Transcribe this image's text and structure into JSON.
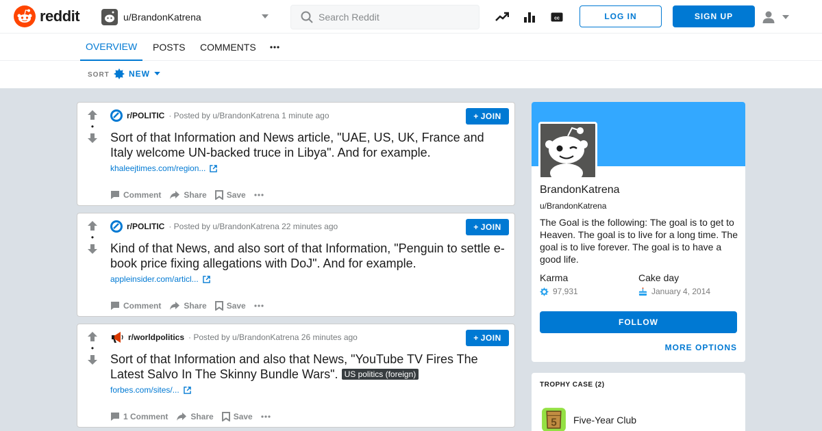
{
  "header": {
    "logo_text": "reddit",
    "user_dropdown_label": "u/BrandonKatrena",
    "search_placeholder": "Search Reddit",
    "login_label": "LOG IN",
    "signup_label": "SIGN UP",
    "icons": [
      "trending-icon",
      "stats-icon",
      "closed-caption-icon",
      "user-icon",
      "chevron-down-icon"
    ]
  },
  "tabs": [
    {
      "label": "OVERVIEW",
      "active": true
    },
    {
      "label": "POSTS",
      "active": false
    },
    {
      "label": "COMMENTS",
      "active": false
    }
  ],
  "sort": {
    "label": "SORT",
    "value": "NEW"
  },
  "posts": [
    {
      "subreddit": "r/POLITIC",
      "meta": "· Posted by u/BrandonKatrena 1 minute ago",
      "join_label": "JOIN",
      "title": "Sort of that Information and News article, \"UAE, US, UK, France and Italy welcome UN-backed truce in Libya\". And for example.",
      "flair": "",
      "link": "khaleejtimes.com/region...",
      "comment_label": "Comment",
      "share_label": "Share",
      "save_label": "Save"
    },
    {
      "subreddit": "r/POLITIC",
      "meta": "· Posted by u/BrandonKatrena 22 minutes ago",
      "join_label": "JOIN",
      "title": "Kind of that News, and also sort of that Information, \"Penguin to settle e-book price fixing allegations with DoJ\". And for example.",
      "flair": "",
      "link": "appleinsider.com/articl...",
      "comment_label": "Comment",
      "share_label": "Share",
      "save_label": "Save"
    },
    {
      "subreddit": "r/worldpolitics",
      "meta": "· Posted by u/BrandonKatrena 26 minutes ago",
      "join_label": "JOIN",
      "title": "Sort of that Information and also that News, \"YouTube TV Fires The Latest Salvo In The Skinny Bundle Wars\".",
      "flair": "US politics (foreign)",
      "link": "forbes.com/sites/...",
      "comment_label": "1 Comment",
      "share_label": "Share",
      "save_label": "Save"
    }
  ],
  "profile": {
    "display_name": "BrandonKatrena",
    "handle": "u/BrandonKatrena",
    "description": "The Goal is the following: The goal is to get to Heaven. The goal is to live for a long time. The goal is to live forever. The goal is to have a good life.",
    "karma_label": "Karma",
    "karma_value": "97,931",
    "cake_label": "Cake day",
    "cake_value": "January 4, 2014",
    "follow_label": "FOLLOW",
    "more_options_label": "MORE OPTIONS",
    "banner_color": "#33a8ff"
  },
  "trophies": {
    "title": "TROPHY CASE (2)",
    "items": [
      {
        "name": "Five-Year Club"
      }
    ]
  },
  "colors": {
    "accent": "#0079d3",
    "reddit_orange": "#ff4500",
    "background": "#dae0e6"
  }
}
